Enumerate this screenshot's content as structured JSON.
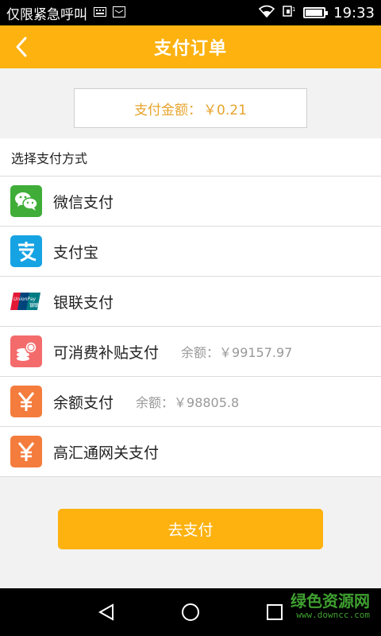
{
  "status_bar": {
    "carrier": "仅限紧急呼叫",
    "time": "19:33",
    "battery_level": 0.85
  },
  "header": {
    "title": "支付订单",
    "back_icon": "chevron-left-icon"
  },
  "amount": {
    "label": "支付金额：",
    "value": "￥0.21"
  },
  "section_title": "选择支付方式",
  "methods": [
    {
      "label": "微信支付",
      "balance": "",
      "icon": "wechat-icon",
      "color": "#3fad38"
    },
    {
      "label": "支付宝",
      "balance": "",
      "icon": "alipay-icon",
      "color": "#16a3e3"
    },
    {
      "label": "银联支付",
      "balance": "",
      "icon": "unionpay-icon",
      "color": "#ffffff"
    },
    {
      "label": "可消费补贴支付",
      "balance": "余额：￥99157.97",
      "icon": "coins-icon",
      "color": "#f36b6b"
    },
    {
      "label": "余额支付",
      "balance": "余额：￥98805.8",
      "icon": "yuan-icon",
      "color": "#f47c3c"
    },
    {
      "label": "高汇通网关支付",
      "balance": "",
      "icon": "yuan-icon",
      "color": "#f47c3c"
    }
  ],
  "pay_button": "去支付",
  "colors": {
    "primary": "#fdb210",
    "amount_text": "#e6a32c"
  },
  "watermark": {
    "cn": "绿色资源网",
    "en": "www.downcc.com"
  }
}
